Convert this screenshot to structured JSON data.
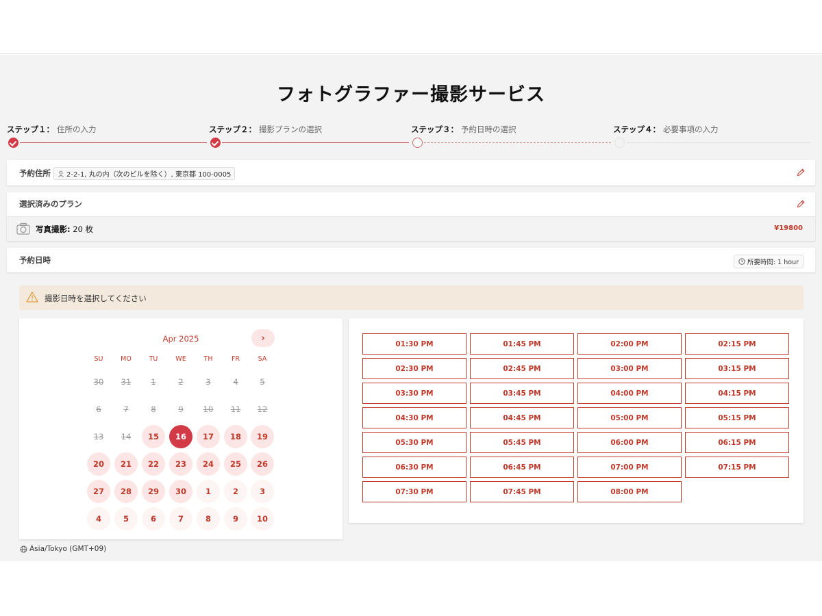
{
  "page_title": "フォトグラファー撮影サービス",
  "steps": [
    {
      "num": "ステップ１：",
      "label": "住所の入力",
      "state": "done"
    },
    {
      "num": "ステップ２：",
      "label": "撮影プランの選択",
      "state": "done"
    },
    {
      "num": "ステップ３：",
      "label": "予約日時の選択",
      "state": "current"
    },
    {
      "num": "ステップ４：",
      "label": "必要事項の入力",
      "state": "future"
    }
  ],
  "address": {
    "label": "予約住所",
    "value": "2-2-1, 丸の内（次のビルを除く）, 東京都 100-0005"
  },
  "plan": {
    "label": "選択済みのプラン",
    "name": "写真撮影:",
    "quantity": "20 枚",
    "price": "¥19800"
  },
  "datetime": {
    "label": "予約日時",
    "duration": "所要時間: 1 hour"
  },
  "alert": {
    "text": "撮影日時を選択してください"
  },
  "calendar": {
    "month": "Apr 2025",
    "next_label": "›",
    "weekdays": [
      "SU",
      "MO",
      "TU",
      "WE",
      "TH",
      "FR",
      "SA"
    ],
    "weeks": [
      [
        [
          "30",
          "disabled"
        ],
        [
          "31",
          "disabled"
        ],
        [
          "1",
          "disabled"
        ],
        [
          "2",
          "disabled"
        ],
        [
          "3",
          "disabled"
        ],
        [
          "4",
          "disabled"
        ],
        [
          "5",
          "disabled"
        ]
      ],
      [
        [
          "6",
          "disabled"
        ],
        [
          "7",
          "disabled"
        ],
        [
          "8",
          "disabled"
        ],
        [
          "9",
          "disabled"
        ],
        [
          "10",
          "disabled"
        ],
        [
          "11",
          "disabled"
        ],
        [
          "12",
          "disabled"
        ]
      ],
      [
        [
          "13",
          "disabled"
        ],
        [
          "14",
          "disabled"
        ],
        [
          "15",
          "available"
        ],
        [
          "16",
          "selected"
        ],
        [
          "17",
          "available"
        ],
        [
          "18",
          "available"
        ],
        [
          "19",
          "available"
        ]
      ],
      [
        [
          "20",
          "available"
        ],
        [
          "21",
          "available"
        ],
        [
          "22",
          "available"
        ],
        [
          "23",
          "available"
        ],
        [
          "24",
          "available"
        ],
        [
          "25",
          "available"
        ],
        [
          "26",
          "available"
        ]
      ],
      [
        [
          "27",
          "available"
        ],
        [
          "28",
          "available"
        ],
        [
          "29",
          "available"
        ],
        [
          "30",
          "available"
        ],
        [
          "1",
          "next"
        ],
        [
          "2",
          "next"
        ],
        [
          "3",
          "next"
        ]
      ],
      [
        [
          "4",
          "next"
        ],
        [
          "5",
          "next"
        ],
        [
          "6",
          "next"
        ],
        [
          "7",
          "next"
        ],
        [
          "8",
          "next"
        ],
        [
          "9",
          "next"
        ],
        [
          "10",
          "next"
        ]
      ]
    ]
  },
  "timezone": "Asia/Tokyo (GMT+09)",
  "time_slots": [
    "01:30 PM",
    "01:45 PM",
    "02:00 PM",
    "02:15 PM",
    "02:30 PM",
    "02:45 PM",
    "03:00 PM",
    "03:15 PM",
    "03:30 PM",
    "03:45 PM",
    "04:00 PM",
    "04:15 PM",
    "04:30 PM",
    "04:45 PM",
    "05:00 PM",
    "05:15 PM",
    "05:30 PM",
    "05:45 PM",
    "06:00 PM",
    "06:15 PM",
    "06:30 PM",
    "06:45 PM",
    "07:00 PM",
    "07:15 PM",
    "07:30 PM",
    "07:45 PM",
    "08:00 PM"
  ],
  "colors": {
    "accent": "#d23a46",
    "accent_text": "#c0392b",
    "alert_bg": "#f3e9dc",
    "page_bg": "#f3f3f3"
  }
}
